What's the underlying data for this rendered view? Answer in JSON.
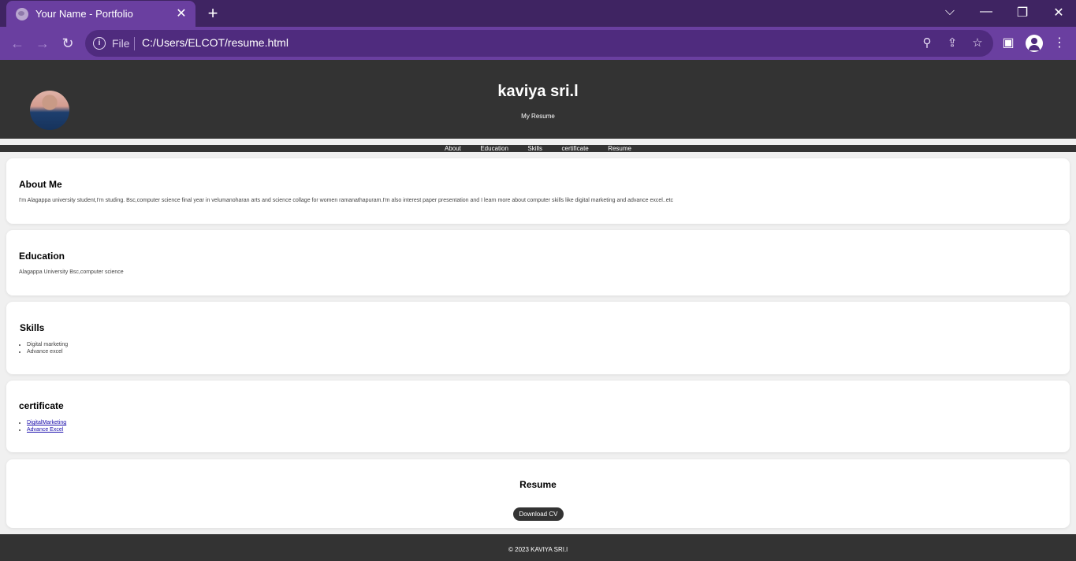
{
  "browser": {
    "tab_title": "Your Name - Portfolio",
    "tab_close": "✕",
    "new_tab": "+",
    "controls": {
      "dropdown": "⌵",
      "minimize": "—",
      "restore": "❐",
      "close": "✕"
    },
    "scheme": "File",
    "url": "C:/Users/ELCOT/resume.html",
    "icons": {
      "back": "←",
      "forward": "→",
      "reload": "↻",
      "zoom": "⚲",
      "share": "⇪",
      "star": "☆",
      "sidepanel": "▣",
      "menu": "⋮",
      "info": "i"
    }
  },
  "header": {
    "name": "kaviya sri.l",
    "tagline": "My Resume"
  },
  "nav": [
    "About",
    "Education",
    "Skills",
    "certificate",
    "Resume"
  ],
  "about": {
    "heading": "About Me",
    "text": "I'm Alagappa university student,I'm studing. Bsc,computer science final year in velumanoharan arts and science collage for women ramanathapuram.I'm also interest paper presentation and I learn more about computer skills like digital marketing and advance excel..etc"
  },
  "education": {
    "heading": "Education",
    "text": "Alagappa University Bsc,computer science"
  },
  "skills": {
    "heading": "Skills",
    "items": [
      "Digital marketing",
      "Advance excel"
    ]
  },
  "certificate": {
    "heading": "certificate",
    "items": [
      "DigitalMarketing",
      "Advance Excel"
    ]
  },
  "resume": {
    "heading": "Resume",
    "button": "Download CV"
  },
  "footer": "© 2023 KAVIYA SRI.l"
}
